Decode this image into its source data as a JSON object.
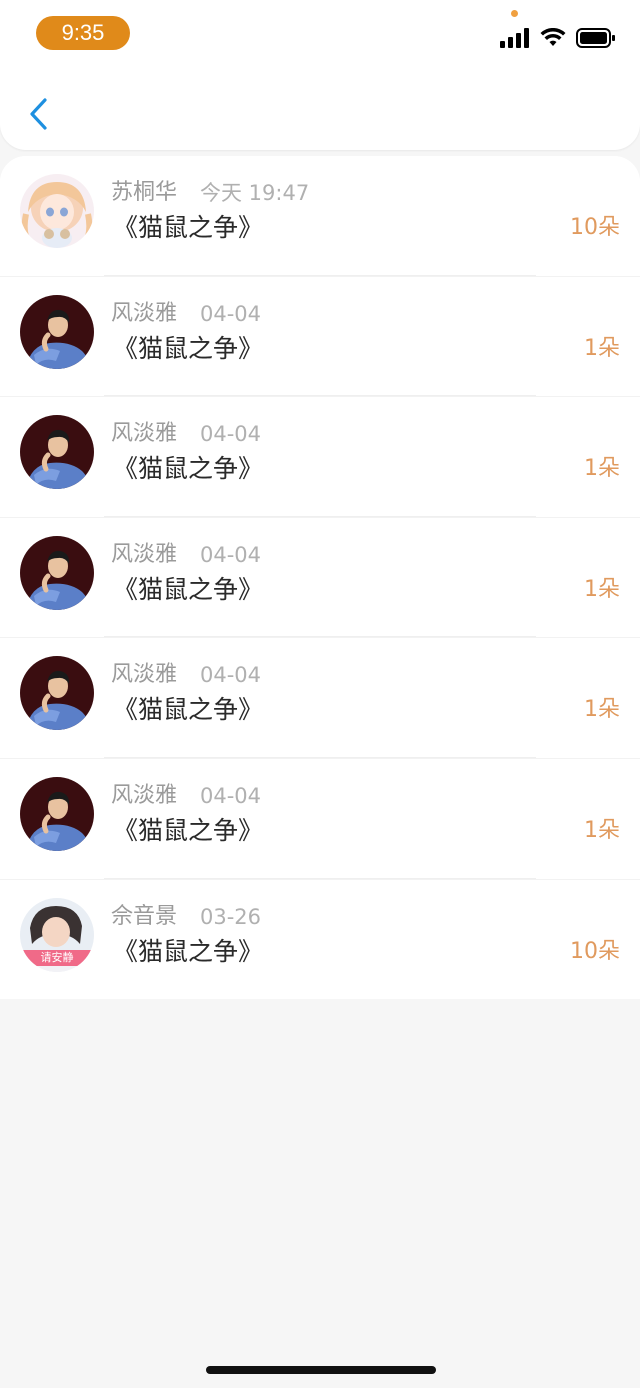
{
  "status_bar": {
    "time": "9:35",
    "icons": [
      "signal-icon",
      "wifi-icon",
      "battery-icon"
    ]
  },
  "nav": {
    "back_icon": "chevron-left-icon",
    "accent": "#1e90e0"
  },
  "colors": {
    "time_pill": "#e08a1a",
    "count_text": "#e09a5e"
  },
  "list": {
    "items": [
      {
        "name": "苏桐华",
        "date": "今天 19:47",
        "title": "《猫鼠之争》",
        "count": "10朵",
        "avatar": "anime-girl-avatar"
      },
      {
        "name": "风淡雅",
        "date": "04-04",
        "title": "《猫鼠之争》",
        "count": "1朵",
        "avatar": "man-blue-shirt-avatar"
      },
      {
        "name": "风淡雅",
        "date": "04-04",
        "title": "《猫鼠之争》",
        "count": "1朵",
        "avatar": "man-blue-shirt-avatar"
      },
      {
        "name": "风淡雅",
        "date": "04-04",
        "title": "《猫鼠之争》",
        "count": "1朵",
        "avatar": "man-blue-shirt-avatar"
      },
      {
        "name": "风淡雅",
        "date": "04-04",
        "title": "《猫鼠之争》",
        "count": "1朵",
        "avatar": "man-blue-shirt-avatar"
      },
      {
        "name": "风淡雅",
        "date": "04-04",
        "title": "《猫鼠之争》",
        "count": "1朵",
        "avatar": "man-blue-shirt-avatar"
      },
      {
        "name": "佘音景",
        "date": "03-26",
        "title": "《猫鼠之争》",
        "count": "10朵",
        "avatar": "girl-please-quiet-avatar",
        "avatar_caption": "请安静"
      }
    ]
  }
}
